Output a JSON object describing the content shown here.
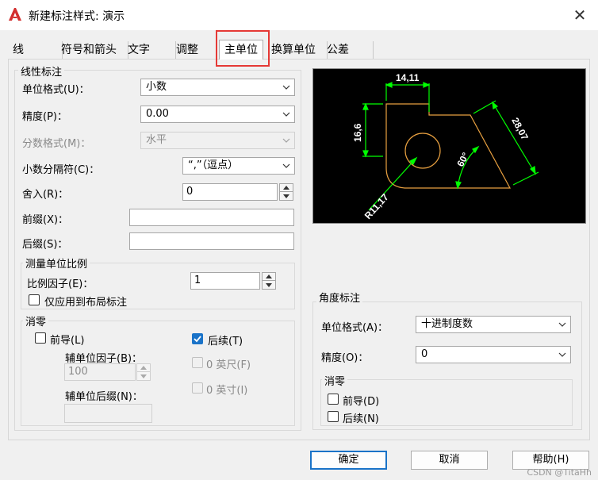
{
  "window": {
    "title": "新建标注样式: 演示"
  },
  "tabs": [
    {
      "label": "线"
    },
    {
      "label": "符号和箭头"
    },
    {
      "label": "文字"
    },
    {
      "label": "调整"
    },
    {
      "label": "主单位"
    },
    {
      "label": "换算单位"
    },
    {
      "label": "公差"
    }
  ],
  "linear": {
    "legend": "线性标注",
    "unit_format_label": "单位格式(U)：",
    "unit_format_value": "小数",
    "precision_label": "精度(P)：",
    "precision_value": "0.00",
    "fraction_label": "分数格式(M)：",
    "fraction_value": "水平",
    "decimal_sep_label": "小数分隔符(C)：",
    "decimal_sep_value": "“,”（逗点）",
    "round_label": "舍入(R)：",
    "round_value": "0",
    "prefix_label": "前缀(X)：",
    "prefix_value": "",
    "suffix_label": "后缀(S)：",
    "suffix_value": ""
  },
  "scale": {
    "legend": "测量单位比例",
    "factor_label": "比例因子(E)：",
    "factor_value": "1",
    "layout_only_label": "仅应用到布局标注"
  },
  "zero_linear": {
    "legend": "消零",
    "leading_label": "前导(L)",
    "sub_factor_label": "辅单位因子(B)：",
    "sub_factor_value": "100",
    "sub_suffix_label": "辅单位后缀(N)：",
    "trailing_label": "后续(T)",
    "feet_label": "0 英尺(F)",
    "inches_label": "0 英寸(I)"
  },
  "preview": {
    "dim_top": "14,11",
    "dim_left": "16,6",
    "dim_diag": "28,07",
    "dim_angle": "60°",
    "dim_radius": "R11,17"
  },
  "angular": {
    "legend": "角度标注",
    "unit_format_label": "单位格式(A)：",
    "unit_format_value": "十进制度数",
    "precision_label": "精度(O)：",
    "precision_value": "0",
    "zero_legend": "消零",
    "leading_label": "前导(D)",
    "trailing_label": "后续(N)"
  },
  "buttons": {
    "ok": "确定",
    "cancel": "取消",
    "help": "帮助(H)"
  },
  "watermark": "CSDN @TitaHh",
  "colors": {
    "highlight": "#e53935",
    "accent": "#1a73c8",
    "preview_dim": "#00ff00",
    "preview_geometry": "#e8a040"
  }
}
